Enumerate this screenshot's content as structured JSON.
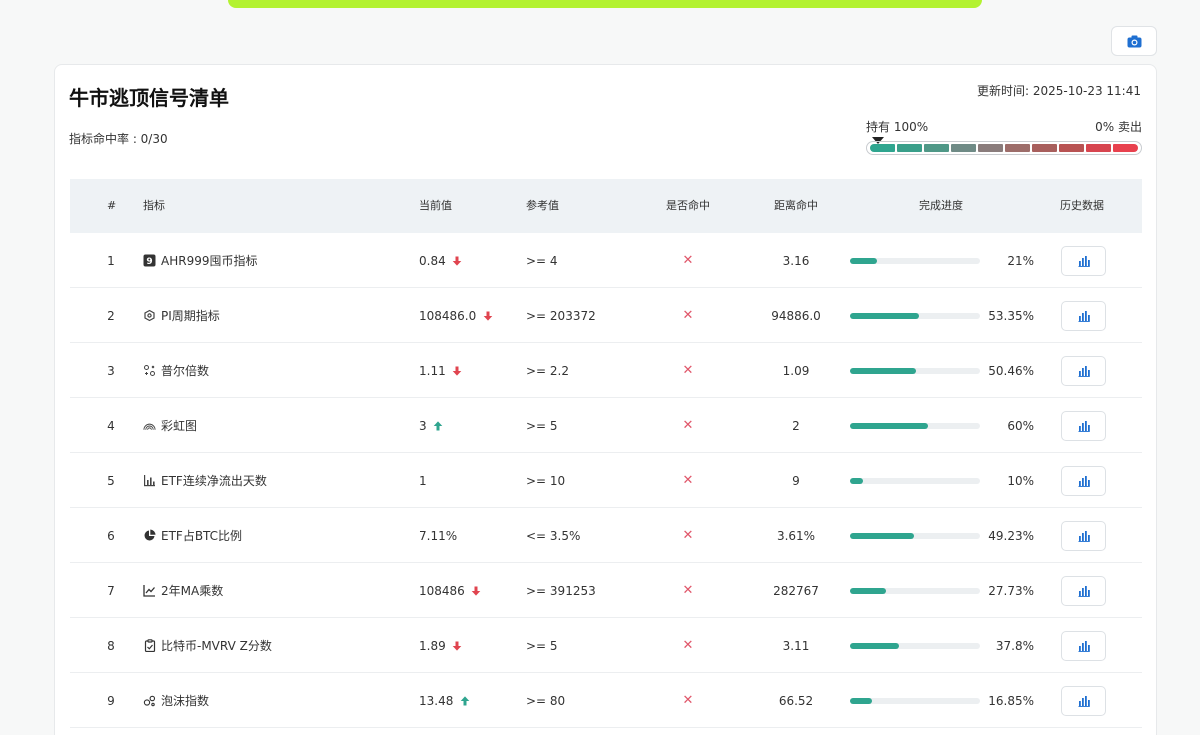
{
  "page": {
    "title": "牛市逃顶信号清单",
    "hit_rate": "指标命中率 : 0/30",
    "update_time": "更新时间: 2025-10-23 11:41"
  },
  "gauge": {
    "left_label": "持有 100%",
    "right_label": "0% 卖出",
    "pointer_fraction": 0.0,
    "segment_colors": [
      "#2fa58f",
      "#3a9f8a",
      "#4f9887",
      "#6f8b86",
      "#8a7c7c",
      "#9d6d6a",
      "#a85f5d",
      "#b85353",
      "#d7454f",
      "#e8414e"
    ]
  },
  "colors": {
    "accent": "#2fa58f",
    "down": "#e0444f",
    "up": "#2fa58f",
    "icon_blue": "#1f6fd1"
  },
  "table": {
    "headers": {
      "index": "#",
      "name": "指标",
      "current": "当前值",
      "reference": "参考值",
      "hit": "是否命中",
      "distance": "距离命中",
      "progress": "完成进度",
      "history": "历史数据"
    },
    "rows": [
      {
        "index": "1",
        "icon": "badge-9-icon",
        "name": "AHR999囤币指标",
        "current": "0.84",
        "trend": "down",
        "reference": ">= 4",
        "hit": "✕",
        "distance": "3.16",
        "progress": 0.21,
        "progress_text": "21%"
      },
      {
        "index": "2",
        "icon": "cycle-icon",
        "name": "PI周期指标",
        "current": "108486.0",
        "trend": "down",
        "reference": ">= 203372",
        "hit": "✕",
        "distance": "94886.0",
        "progress": 0.5335,
        "progress_text": "53.35%"
      },
      {
        "index": "3",
        "icon": "multiplier-icon",
        "name": "普尔倍数",
        "current": "1.11",
        "trend": "down",
        "reference": ">= 2.2",
        "hit": "✕",
        "distance": "1.09",
        "progress": 0.5046,
        "progress_text": "50.46%"
      },
      {
        "index": "4",
        "icon": "rainbow-icon",
        "name": "彩虹图",
        "current": "3",
        "trend": "up",
        "reference": ">= 5",
        "hit": "✕",
        "distance": "2",
        "progress": 0.6,
        "progress_text": "60%"
      },
      {
        "index": "5",
        "icon": "bar-chart-icon",
        "name": "ETF连续净流出天数",
        "current": "1",
        "trend": "none",
        "reference": ">= 10",
        "hit": "✕",
        "distance": "9",
        "progress": 0.1,
        "progress_text": "10%"
      },
      {
        "index": "6",
        "icon": "pie-chart-icon",
        "name": "ETF占BTC比例",
        "current": "7.11%",
        "trend": "none",
        "reference": "<= 3.5%",
        "hit": "✕",
        "distance": "3.61%",
        "progress": 0.4923,
        "progress_text": "49.23%"
      },
      {
        "index": "7",
        "icon": "line-chart-icon",
        "name": "2年MA乘数",
        "current": "108486",
        "trend": "down",
        "reference": ">= 391253",
        "hit": "✕",
        "distance": "282767",
        "progress": 0.2773,
        "progress_text": "27.73%"
      },
      {
        "index": "8",
        "icon": "clipboard-icon",
        "name": "比特币-MVRV Z分数",
        "current": "1.89",
        "trend": "down",
        "reference": ">= 5",
        "hit": "✕",
        "distance": "3.11",
        "progress": 0.378,
        "progress_text": "37.8%"
      },
      {
        "index": "9",
        "icon": "bubble-icon",
        "name": "泡沫指数",
        "current": "13.48",
        "trend": "up",
        "reference": ">= 80",
        "hit": "✕",
        "distance": "66.52",
        "progress": 0.1685,
        "progress_text": "16.85%"
      }
    ]
  }
}
